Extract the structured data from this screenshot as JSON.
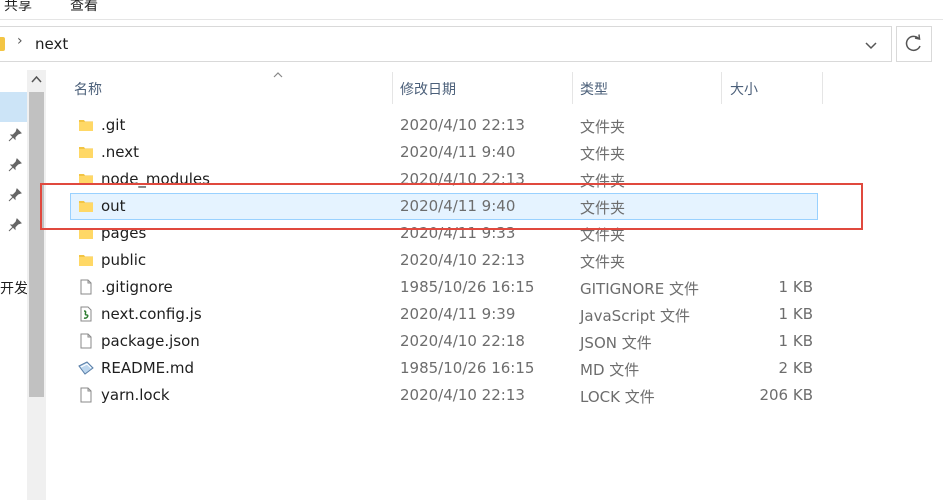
{
  "ribbon": {
    "tabs": [
      "共享",
      "查看"
    ]
  },
  "address": {
    "path": "next"
  },
  "sidebar": {
    "partial_label": "开发"
  },
  "columns": {
    "name": "名称",
    "date": "修改日期",
    "type": "类型",
    "size": "大小"
  },
  "files": [
    {
      "name": ".git",
      "date": "2020/4/10 22:13",
      "type": "文件夹",
      "size": "",
      "icon": "folder-icon"
    },
    {
      "name": ".next",
      "date": "2020/4/11 9:40",
      "type": "文件夹",
      "size": "",
      "icon": "folder-icon"
    },
    {
      "name": "node_modules",
      "date": "2020/4/10 22:13",
      "type": "文件夹",
      "size": "",
      "icon": "folder-icon"
    },
    {
      "name": "out",
      "date": "2020/4/11 9:40",
      "type": "文件夹",
      "size": "",
      "icon": "folder-icon"
    },
    {
      "name": "pages",
      "date": "2020/4/11 9:33",
      "type": "文件夹",
      "size": "",
      "icon": "folder-icon"
    },
    {
      "name": "public",
      "date": "2020/4/10 22:13",
      "type": "文件夹",
      "size": "",
      "icon": "folder-icon"
    },
    {
      "name": ".gitignore",
      "date": "1985/10/26 16:15",
      "type": "GITIGNORE 文件",
      "size": "1 KB",
      "icon": "file-icon"
    },
    {
      "name": "next.config.js",
      "date": "2020/4/11 9:39",
      "type": "JavaScript 文件",
      "size": "1 KB",
      "icon": "script-file-icon"
    },
    {
      "name": "package.json",
      "date": "2020/4/10 22:18",
      "type": "JSON 文件",
      "size": "1 KB",
      "icon": "file-icon"
    },
    {
      "name": "README.md",
      "date": "1985/10/26 16:15",
      "type": "MD 文件",
      "size": "2 KB",
      "icon": "markdown-file-icon"
    },
    {
      "name": "yarn.lock",
      "date": "2020/4/10 22:13",
      "type": "LOCK 文件",
      "size": "206 KB",
      "icon": "file-icon"
    }
  ],
  "colors": {
    "highlight": "#e0493e",
    "selection": "#e5f3ff",
    "folder": "#f3c544"
  }
}
